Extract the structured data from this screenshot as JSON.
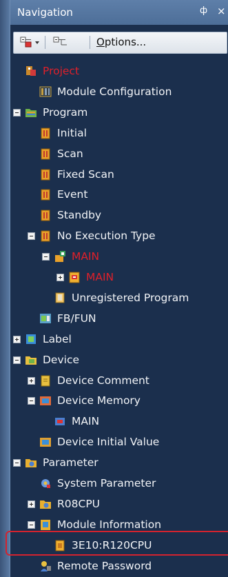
{
  "window": {
    "title": "Navigation",
    "pin_glyph": "ф",
    "close_glyph": "×"
  },
  "toolbar": {
    "options_underlined": "O",
    "options_rest": "ptions..."
  },
  "tree": [
    {
      "label": "Project",
      "level": 0,
      "icon": "project-icon",
      "color": "red",
      "expander": "none"
    },
    {
      "label": "Module Configuration",
      "level": 1,
      "icon": "module-configuration-icon",
      "expander": "none"
    },
    {
      "label": "Program",
      "level": 0,
      "icon": "program-folder-icon",
      "expander": "minus"
    },
    {
      "label": "Initial",
      "level": 1,
      "icon": "program-file-icon",
      "expander": "none"
    },
    {
      "label": "Scan",
      "level": 1,
      "icon": "program-file-icon",
      "expander": "none"
    },
    {
      "label": "Fixed Scan",
      "level": 1,
      "icon": "program-file-icon",
      "expander": "none"
    },
    {
      "label": "Event",
      "level": 1,
      "icon": "program-file-icon",
      "expander": "none"
    },
    {
      "label": "Standby",
      "level": 1,
      "icon": "program-file-icon",
      "expander": "none"
    },
    {
      "label": "No Execution Type",
      "level": 1,
      "icon": "program-file-icon",
      "expander": "minus"
    },
    {
      "label": "MAIN",
      "level": 2,
      "icon": "program-block-icon",
      "color": "red",
      "expander": "minus"
    },
    {
      "label": "MAIN",
      "level": 3,
      "icon": "ladder-program-icon",
      "color": "red",
      "expander": "plus"
    },
    {
      "label": "Unregistered Program",
      "level": 2,
      "icon": "unregistered-program-icon",
      "expander": "none"
    },
    {
      "label": "FB/FUN",
      "level": 1,
      "icon": "fb-fun-icon",
      "expander": "none"
    },
    {
      "label": "Label",
      "level": 0,
      "icon": "label-icon",
      "expander": "plus"
    },
    {
      "label": "Device",
      "level": 0,
      "icon": "device-folder-icon",
      "expander": "minus"
    },
    {
      "label": "Device Comment",
      "level": 1,
      "icon": "device-comment-icon",
      "expander": "plus"
    },
    {
      "label": "Device Memory",
      "level": 1,
      "icon": "device-memory-icon",
      "expander": "minus"
    },
    {
      "label": "MAIN",
      "level": 2,
      "icon": "device-memory-file-icon",
      "expander": "none"
    },
    {
      "label": "Device Initial Value",
      "level": 1,
      "icon": "device-initial-value-icon",
      "expander": "none"
    },
    {
      "label": "Parameter",
      "level": 0,
      "icon": "parameter-folder-icon",
      "expander": "minus"
    },
    {
      "label": "System Parameter",
      "level": 1,
      "icon": "system-parameter-icon",
      "expander": "none",
      "highlighted": true
    },
    {
      "label": "R08CPU",
      "level": 1,
      "icon": "cpu-parameter-icon",
      "expander": "plus"
    },
    {
      "label": "Module Information",
      "level": 1,
      "icon": "module-information-icon",
      "expander": "minus"
    },
    {
      "label": "3E10:R120CPU",
      "level": 2,
      "icon": "module-info-file-icon",
      "expander": "none"
    },
    {
      "label": "Remote Password",
      "level": 1,
      "icon": "remote-password-icon",
      "expander": "none"
    }
  ],
  "colors": {
    "tree_background": "#1b2f4d",
    "text": "#f2f4f7",
    "red_text": "#e0202a",
    "highlight_border": "#d4232e"
  }
}
